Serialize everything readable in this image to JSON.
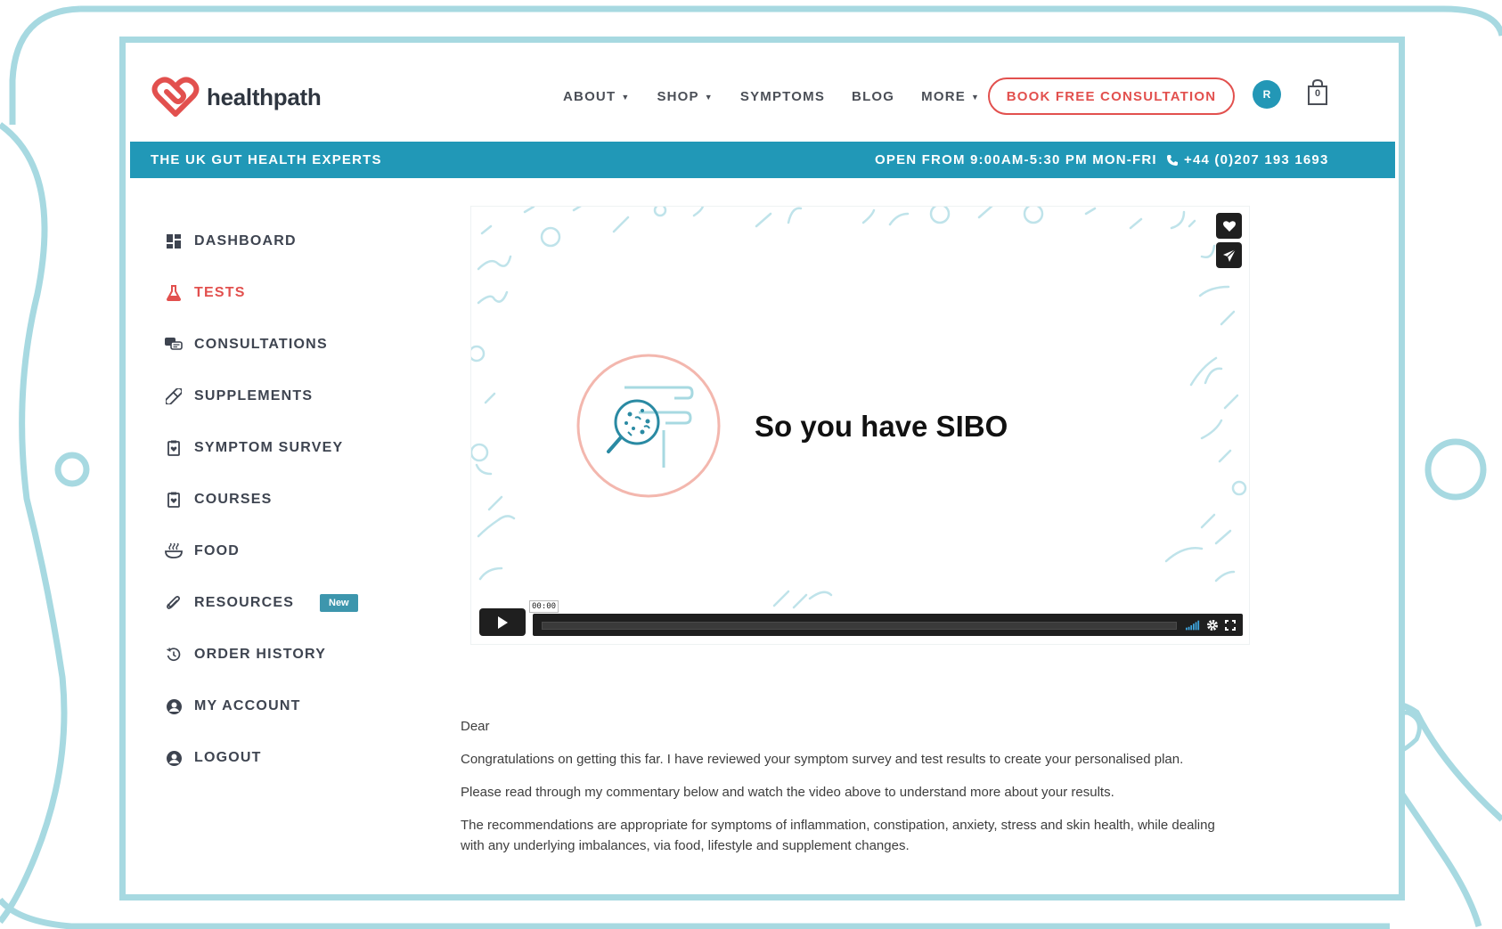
{
  "brand": {
    "name": "healthpath",
    "logo_icon": "heart-logo-icon",
    "accent": "#e2504e",
    "primary": "#2198b7"
  },
  "nav": {
    "items": [
      {
        "label": "ABOUT",
        "has_menu": true
      },
      {
        "label": "SHOP",
        "has_menu": true
      },
      {
        "label": "SYMPTOMS",
        "has_menu": false
      },
      {
        "label": "BLOG",
        "has_menu": false
      },
      {
        "label": "MORE",
        "has_menu": true
      }
    ],
    "cta_label": "BOOK FREE CONSULTATION",
    "avatar_initial": "R",
    "cart_count": "0"
  },
  "info_bar": {
    "tagline": "THE UK GUT HEALTH EXPERTS",
    "hours": "OPEN FROM 9:00AM-5:30 PM MON-FRI",
    "phone": "+44 (0)207 193 1693"
  },
  "sidebar": {
    "items": [
      {
        "label": "DASHBOARD",
        "icon": "dashboard-icon",
        "active": false
      },
      {
        "label": "TESTS",
        "icon": "flask-icon",
        "active": true
      },
      {
        "label": "CONSULTATIONS",
        "icon": "chat-icon",
        "active": false
      },
      {
        "label": "SUPPLEMENTS",
        "icon": "pill-icon",
        "active": false
      },
      {
        "label": "SYMPTOM SURVEY",
        "icon": "clipboard-icon",
        "active": false
      },
      {
        "label": "COURSES",
        "icon": "clipboard-icon",
        "active": false
      },
      {
        "label": "FOOD",
        "icon": "bowl-icon",
        "active": false
      },
      {
        "label": "RESOURCES",
        "icon": "paperclip-icon",
        "active": false,
        "badge": "New"
      },
      {
        "label": "ORDER HISTORY",
        "icon": "history-icon",
        "active": false
      },
      {
        "label": "MY ACCOUNT",
        "icon": "user-icon",
        "active": false
      },
      {
        "label": "LOGOUT",
        "icon": "user-icon",
        "active": false
      }
    ]
  },
  "video": {
    "title": "So you have SIBO",
    "timecode": "00:00",
    "progress": 0
  },
  "letter": {
    "greeting": "Dear",
    "paragraphs": [
      "Congratulations on getting this far. I have reviewed your symptom survey and test results to create your personalised plan.",
      "Please read through my commentary below and watch the video above to understand more about your results.",
      "The recommendations are appropriate for symptoms of inflammation, constipation, anxiety, stress and skin health, while dealing with any underlying imbalances, via food, lifestyle and supplement changes."
    ]
  }
}
